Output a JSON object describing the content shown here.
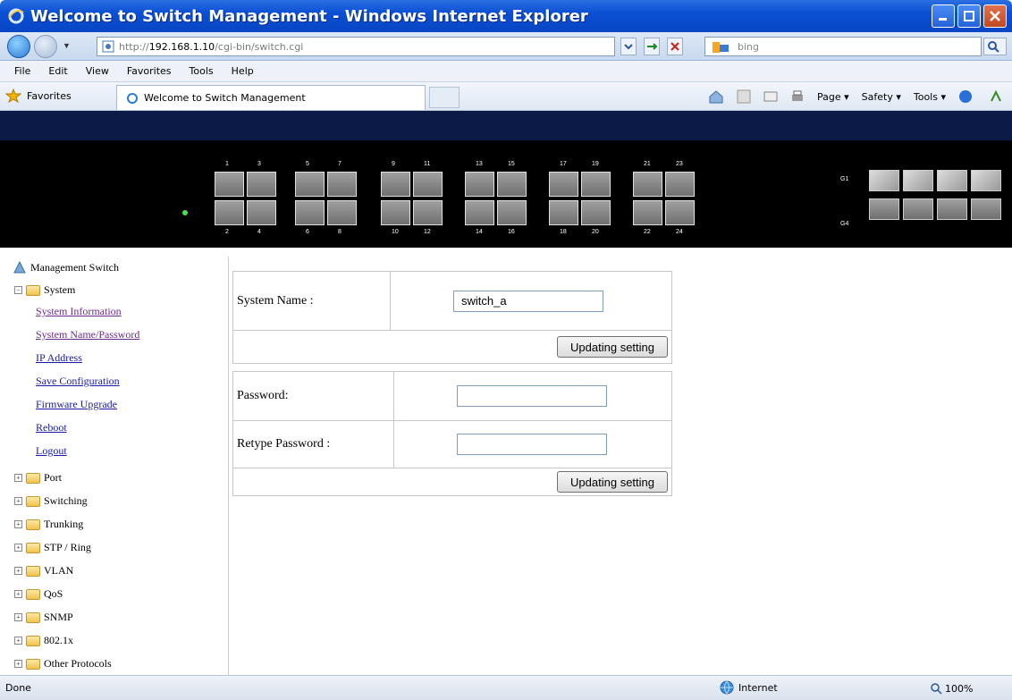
{
  "window": {
    "title": "Welcome to Switch Management - Windows Internet Explorer"
  },
  "address": {
    "url_prefix": "http://",
    "url_host": "192.168.1.10",
    "url_path": "/cgi-bin/switch.cgi",
    "search_placeholder": "bing"
  },
  "menu": [
    "File",
    "Edit",
    "View",
    "Favorites",
    "Tools",
    "Help"
  ],
  "favbar": {
    "favorites_label": "Favorites",
    "tab_title": "Welcome to Switch Management",
    "commands": [
      "Page ▾",
      "Safety ▾",
      "Tools ▾"
    ]
  },
  "banner": {
    "top_port_labels": [
      "1",
      "3",
      "5",
      "7",
      "9",
      "11",
      "13",
      "15",
      "17",
      "19",
      "21",
      "23"
    ],
    "bottom_port_labels": [
      "2",
      "4",
      "6",
      "8",
      "10",
      "12",
      "14",
      "16",
      "18",
      "20",
      "22",
      "24"
    ],
    "uplink_labels": [
      "G1",
      "G4"
    ]
  },
  "sidebar": {
    "root": "Management Switch",
    "system": "System",
    "system_children": [
      "System Information",
      "System Name/Password",
      "IP Address",
      "Save Configuration",
      "Firmware Upgrade",
      "Reboot",
      "Logout"
    ],
    "folders": [
      "Port",
      "Switching",
      "Trunking",
      "STP / Ring",
      "VLAN",
      "QoS",
      "SNMP",
      "802.1x",
      "Other Protocols"
    ]
  },
  "form1": {
    "label": "System Name :",
    "value": "switch_a",
    "button": "Updating setting"
  },
  "form2": {
    "password_label": "Password:",
    "retype_label": "Retype Password :",
    "button": "Updating setting"
  },
  "status": {
    "left": "Done",
    "zone": "Internet",
    "zoom": "100%"
  }
}
